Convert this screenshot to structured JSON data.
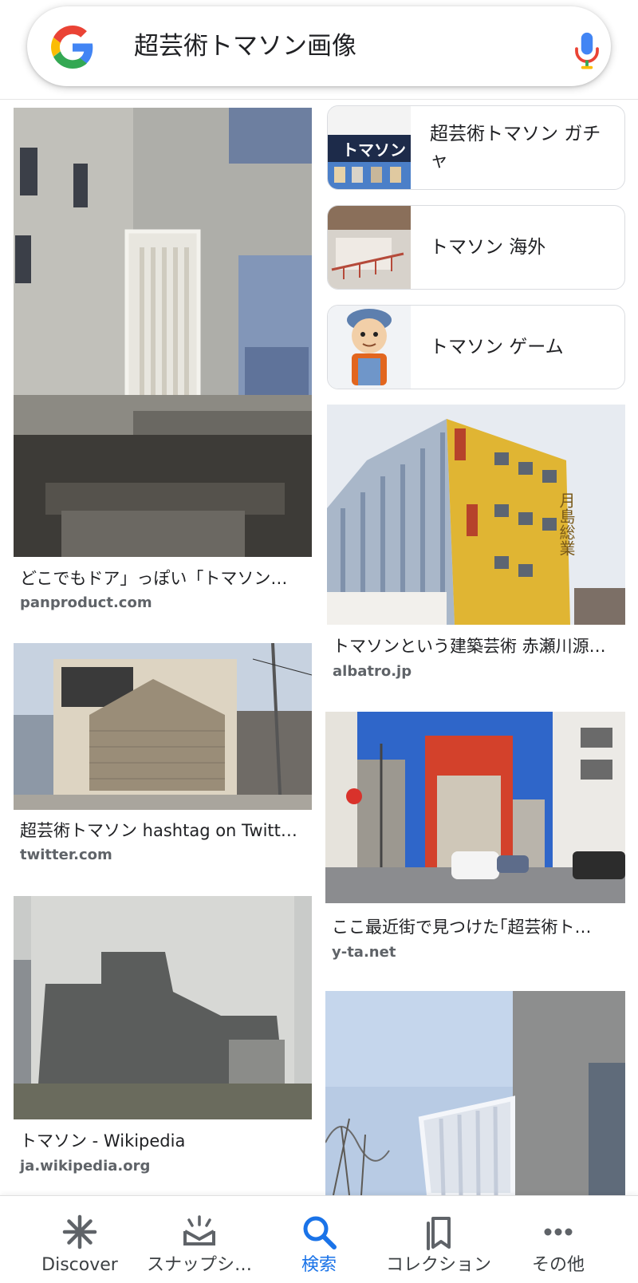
{
  "search": {
    "query": "超芸術トマソン画像",
    "logo_icon": "google-g-icon",
    "mic_icon": "mic-icon"
  },
  "related": [
    {
      "label": "超芸術トマソン ガチャ",
      "thumb_text": "トマソン"
    },
    {
      "label": "トマソン 海外"
    },
    {
      "label": "トマソン ゲーム"
    }
  ],
  "results": [
    {
      "title": "どこでもドア」っぽい「トマソン…",
      "source": "panproduct.com"
    },
    {
      "title": "トマソンという建築芸術 赤瀬川源…",
      "source": "albatro.jp",
      "sign_text": "月島総業"
    },
    {
      "title": "超芸術トマソン hashtag on Twitt…",
      "source": "twitter.com"
    },
    {
      "title": "ここ最近街で見つけた｢超芸術ト…",
      "source": "y-ta.net"
    },
    {
      "title": "トマソン - Wikipedia",
      "source": "ja.wikipedia.org"
    }
  ],
  "nav": [
    {
      "label": "Discover",
      "icon": "asterisk-icon"
    },
    {
      "label": "スナップシ…",
      "icon": "snapshot-icon"
    },
    {
      "label": "検索",
      "icon": "search-icon",
      "active": true
    },
    {
      "label": "コレクション",
      "icon": "collections-icon"
    },
    {
      "label": "その他",
      "icon": "more-icon"
    }
  ],
  "colors": {
    "accent": "#1a73e8",
    "text": "#202124",
    "secondary": "#5f6368"
  }
}
